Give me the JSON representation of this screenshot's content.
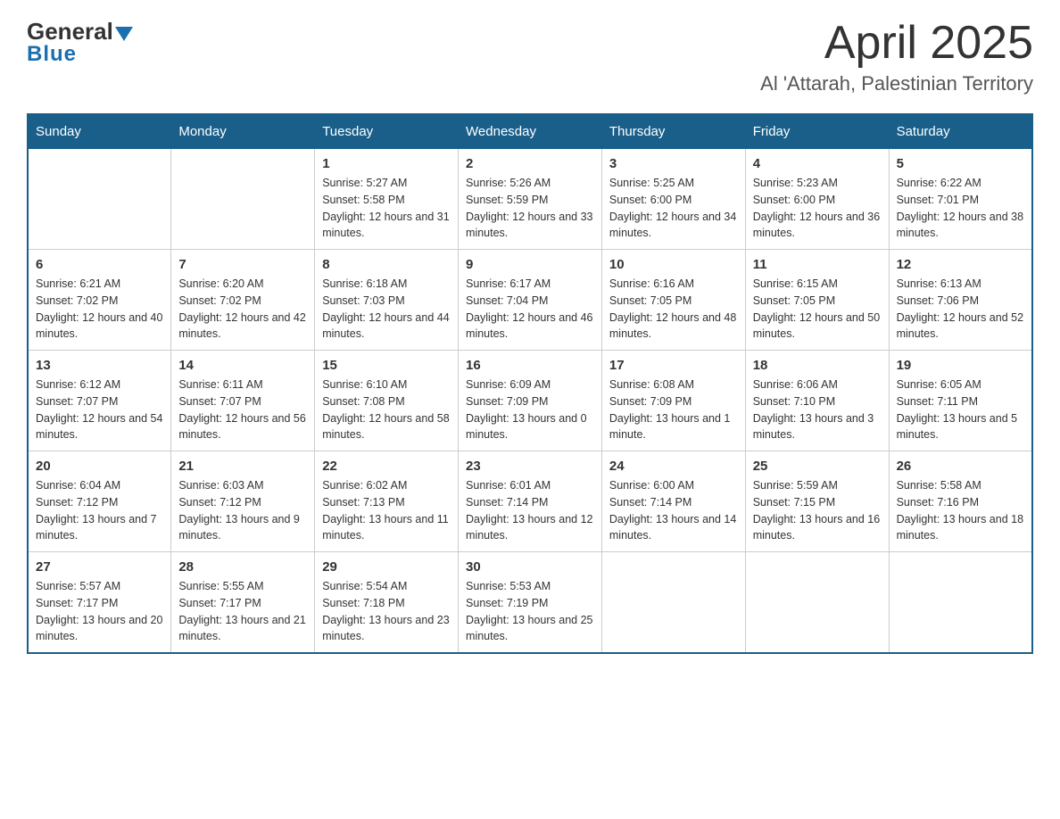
{
  "header": {
    "logo_general": "General",
    "logo_blue": "Blue",
    "month_title": "April 2025",
    "location": "Al 'Attarah, Palestinian Territory"
  },
  "days_of_week": [
    "Sunday",
    "Monday",
    "Tuesday",
    "Wednesday",
    "Thursday",
    "Friday",
    "Saturday"
  ],
  "weeks": [
    [
      {
        "day": "",
        "sunrise": "",
        "sunset": "",
        "daylight": ""
      },
      {
        "day": "",
        "sunrise": "",
        "sunset": "",
        "daylight": ""
      },
      {
        "day": "1",
        "sunrise": "Sunrise: 5:27 AM",
        "sunset": "Sunset: 5:58 PM",
        "daylight": "Daylight: 12 hours and 31 minutes."
      },
      {
        "day": "2",
        "sunrise": "Sunrise: 5:26 AM",
        "sunset": "Sunset: 5:59 PM",
        "daylight": "Daylight: 12 hours and 33 minutes."
      },
      {
        "day": "3",
        "sunrise": "Sunrise: 5:25 AM",
        "sunset": "Sunset: 6:00 PM",
        "daylight": "Daylight: 12 hours and 34 minutes."
      },
      {
        "day": "4",
        "sunrise": "Sunrise: 5:23 AM",
        "sunset": "Sunset: 6:00 PM",
        "daylight": "Daylight: 12 hours and 36 minutes."
      },
      {
        "day": "5",
        "sunrise": "Sunrise: 6:22 AM",
        "sunset": "Sunset: 7:01 PM",
        "daylight": "Daylight: 12 hours and 38 minutes."
      }
    ],
    [
      {
        "day": "6",
        "sunrise": "Sunrise: 6:21 AM",
        "sunset": "Sunset: 7:02 PM",
        "daylight": "Daylight: 12 hours and 40 minutes."
      },
      {
        "day": "7",
        "sunrise": "Sunrise: 6:20 AM",
        "sunset": "Sunset: 7:02 PM",
        "daylight": "Daylight: 12 hours and 42 minutes."
      },
      {
        "day": "8",
        "sunrise": "Sunrise: 6:18 AM",
        "sunset": "Sunset: 7:03 PM",
        "daylight": "Daylight: 12 hours and 44 minutes."
      },
      {
        "day": "9",
        "sunrise": "Sunrise: 6:17 AM",
        "sunset": "Sunset: 7:04 PM",
        "daylight": "Daylight: 12 hours and 46 minutes."
      },
      {
        "day": "10",
        "sunrise": "Sunrise: 6:16 AM",
        "sunset": "Sunset: 7:05 PM",
        "daylight": "Daylight: 12 hours and 48 minutes."
      },
      {
        "day": "11",
        "sunrise": "Sunrise: 6:15 AM",
        "sunset": "Sunset: 7:05 PM",
        "daylight": "Daylight: 12 hours and 50 minutes."
      },
      {
        "day": "12",
        "sunrise": "Sunrise: 6:13 AM",
        "sunset": "Sunset: 7:06 PM",
        "daylight": "Daylight: 12 hours and 52 minutes."
      }
    ],
    [
      {
        "day": "13",
        "sunrise": "Sunrise: 6:12 AM",
        "sunset": "Sunset: 7:07 PM",
        "daylight": "Daylight: 12 hours and 54 minutes."
      },
      {
        "day": "14",
        "sunrise": "Sunrise: 6:11 AM",
        "sunset": "Sunset: 7:07 PM",
        "daylight": "Daylight: 12 hours and 56 minutes."
      },
      {
        "day": "15",
        "sunrise": "Sunrise: 6:10 AM",
        "sunset": "Sunset: 7:08 PM",
        "daylight": "Daylight: 12 hours and 58 minutes."
      },
      {
        "day": "16",
        "sunrise": "Sunrise: 6:09 AM",
        "sunset": "Sunset: 7:09 PM",
        "daylight": "Daylight: 13 hours and 0 minutes."
      },
      {
        "day": "17",
        "sunrise": "Sunrise: 6:08 AM",
        "sunset": "Sunset: 7:09 PM",
        "daylight": "Daylight: 13 hours and 1 minute."
      },
      {
        "day": "18",
        "sunrise": "Sunrise: 6:06 AM",
        "sunset": "Sunset: 7:10 PM",
        "daylight": "Daylight: 13 hours and 3 minutes."
      },
      {
        "day": "19",
        "sunrise": "Sunrise: 6:05 AM",
        "sunset": "Sunset: 7:11 PM",
        "daylight": "Daylight: 13 hours and 5 minutes."
      }
    ],
    [
      {
        "day": "20",
        "sunrise": "Sunrise: 6:04 AM",
        "sunset": "Sunset: 7:12 PM",
        "daylight": "Daylight: 13 hours and 7 minutes."
      },
      {
        "day": "21",
        "sunrise": "Sunrise: 6:03 AM",
        "sunset": "Sunset: 7:12 PM",
        "daylight": "Daylight: 13 hours and 9 minutes."
      },
      {
        "day": "22",
        "sunrise": "Sunrise: 6:02 AM",
        "sunset": "Sunset: 7:13 PM",
        "daylight": "Daylight: 13 hours and 11 minutes."
      },
      {
        "day": "23",
        "sunrise": "Sunrise: 6:01 AM",
        "sunset": "Sunset: 7:14 PM",
        "daylight": "Daylight: 13 hours and 12 minutes."
      },
      {
        "day": "24",
        "sunrise": "Sunrise: 6:00 AM",
        "sunset": "Sunset: 7:14 PM",
        "daylight": "Daylight: 13 hours and 14 minutes."
      },
      {
        "day": "25",
        "sunrise": "Sunrise: 5:59 AM",
        "sunset": "Sunset: 7:15 PM",
        "daylight": "Daylight: 13 hours and 16 minutes."
      },
      {
        "day": "26",
        "sunrise": "Sunrise: 5:58 AM",
        "sunset": "Sunset: 7:16 PM",
        "daylight": "Daylight: 13 hours and 18 minutes."
      }
    ],
    [
      {
        "day": "27",
        "sunrise": "Sunrise: 5:57 AM",
        "sunset": "Sunset: 7:17 PM",
        "daylight": "Daylight: 13 hours and 20 minutes."
      },
      {
        "day": "28",
        "sunrise": "Sunrise: 5:55 AM",
        "sunset": "Sunset: 7:17 PM",
        "daylight": "Daylight: 13 hours and 21 minutes."
      },
      {
        "day": "29",
        "sunrise": "Sunrise: 5:54 AM",
        "sunset": "Sunset: 7:18 PM",
        "daylight": "Daylight: 13 hours and 23 minutes."
      },
      {
        "day": "30",
        "sunrise": "Sunrise: 5:53 AM",
        "sunset": "Sunset: 7:19 PM",
        "daylight": "Daylight: 13 hours and 25 minutes."
      },
      {
        "day": "",
        "sunrise": "",
        "sunset": "",
        "daylight": ""
      },
      {
        "day": "",
        "sunrise": "",
        "sunset": "",
        "daylight": ""
      },
      {
        "day": "",
        "sunrise": "",
        "sunset": "",
        "daylight": ""
      }
    ]
  ]
}
